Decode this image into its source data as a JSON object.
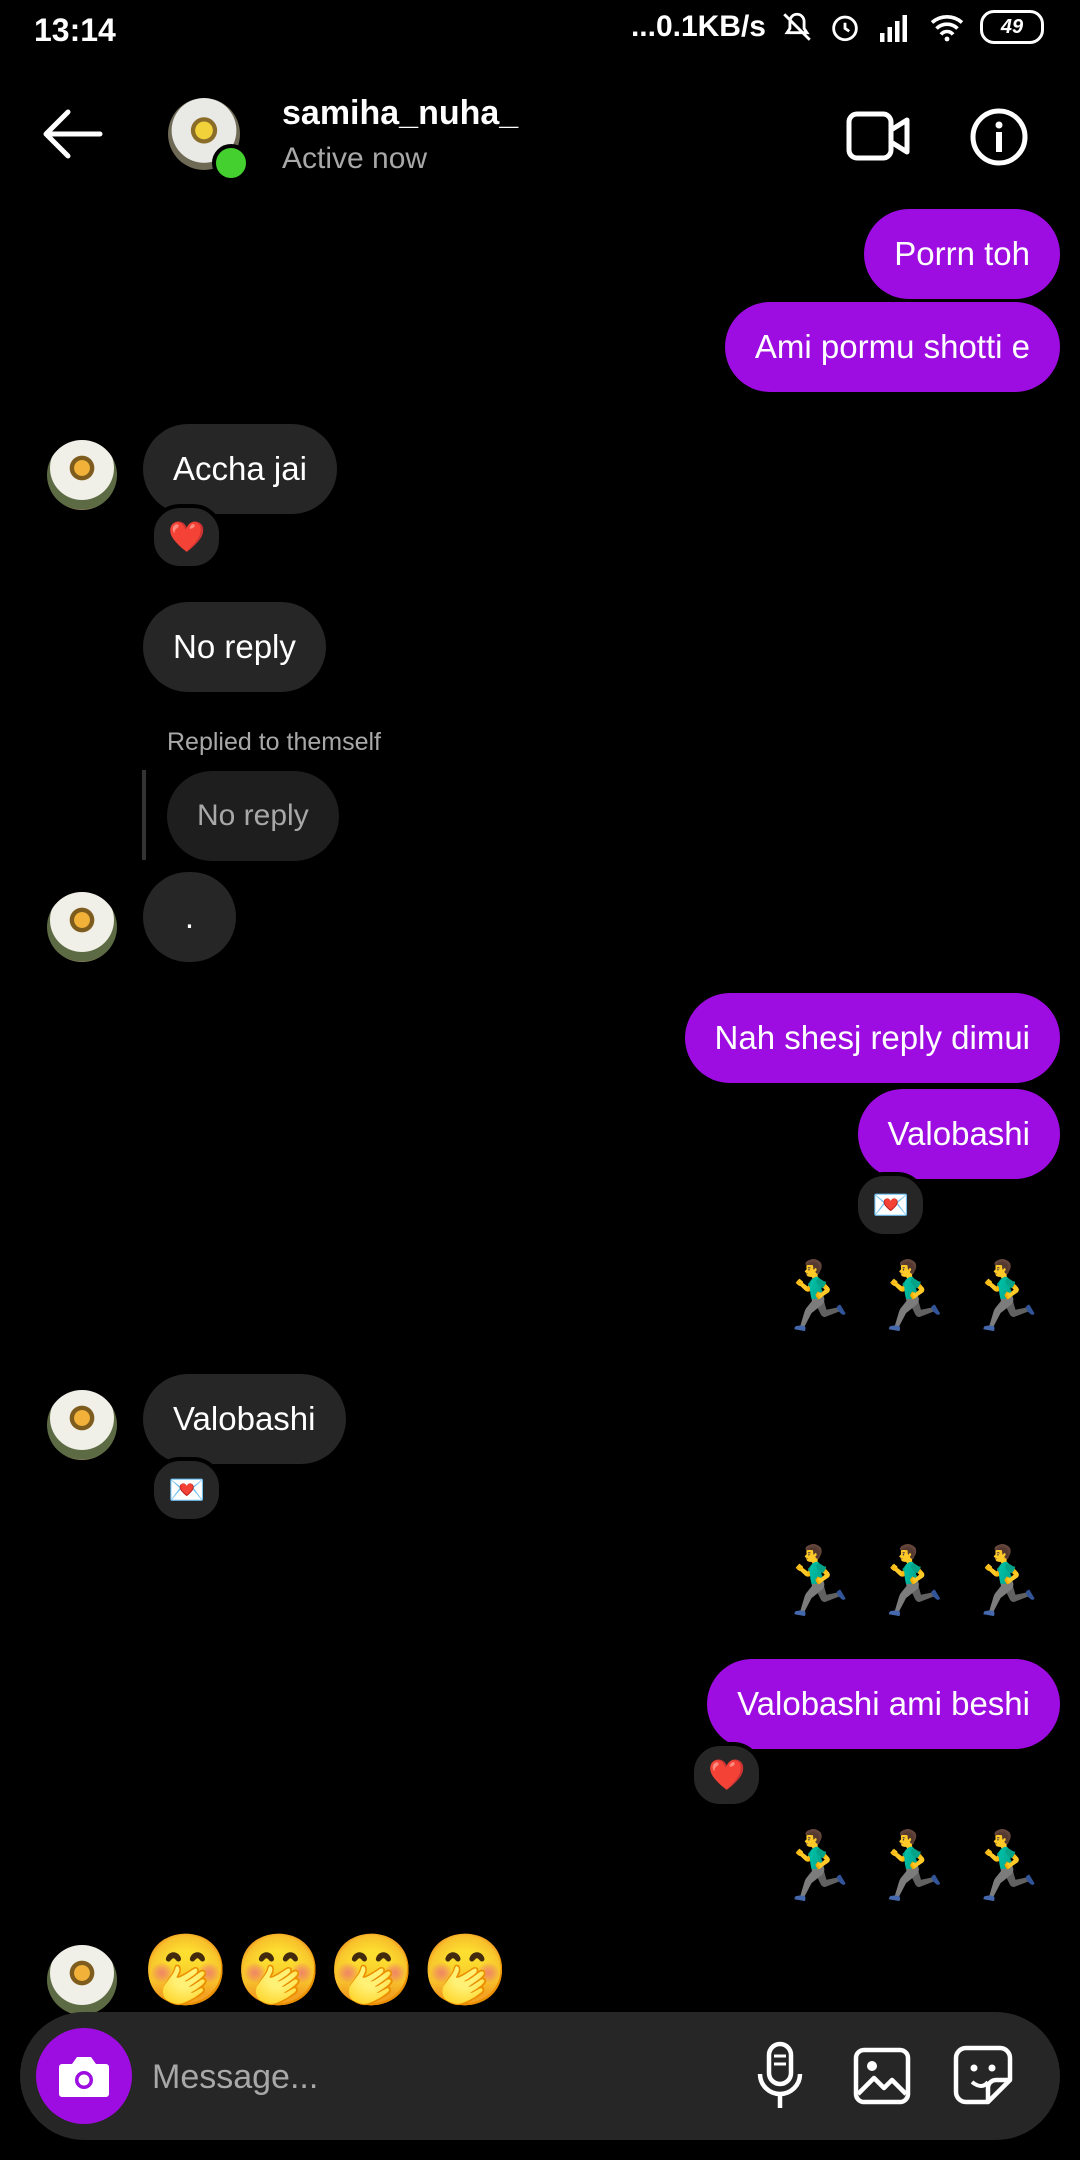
{
  "status_bar": {
    "time": "13:14",
    "network": "...0.1KB/s",
    "battery": "49"
  },
  "header": {
    "username": "samiha_nuha_",
    "status": "Active now"
  },
  "messages": {
    "m1": "Porrn toh",
    "m2": "Ami pormu shotti e",
    "m3": "Accha jai",
    "m3_reaction": "❤️",
    "m4": "No reply",
    "reply_label": "Replied to themself",
    "m5_quote": "No reply",
    "m6": ".",
    "m7": "Nah shesj reply dimui",
    "m8": "Valobashi",
    "m8_reaction": "💌",
    "m9": "🏃‍♂️🏃‍♂️🏃‍♂️",
    "m10": "Valobashi",
    "m10_reaction": "💌",
    "m11": "🏃‍♂️🏃‍♂️🏃‍♂️",
    "m12": "Valobashi ami beshi",
    "m12_reaction": "❤️",
    "m13": "🏃‍♂️🏃‍♂️🏃‍♂️",
    "m14": "🤭🤭🤭🤭"
  },
  "composer": {
    "placeholder": "Message..."
  },
  "colors": {
    "sent_bubble": "#9d0ce0",
    "received_bubble": "#262626",
    "online": "#44d12f"
  }
}
